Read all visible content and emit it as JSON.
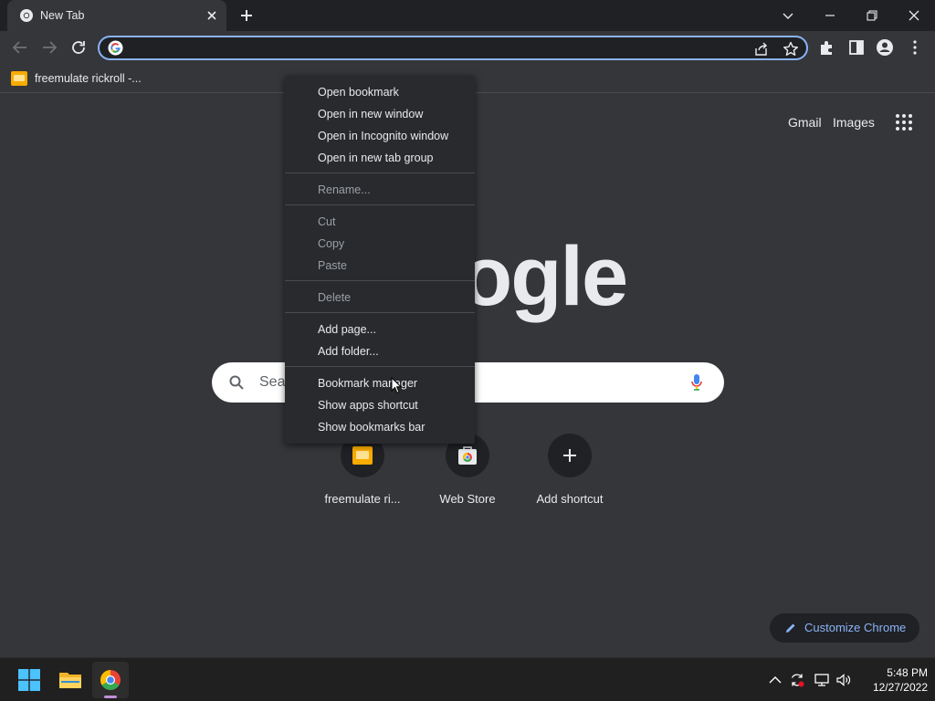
{
  "tab": {
    "title": "New Tab"
  },
  "omnibox": {
    "value": ""
  },
  "bookmarks_bar": {
    "items": [
      {
        "label": "freemulate rickroll -..."
      }
    ]
  },
  "ntp": {
    "top_links": {
      "gmail": "Gmail",
      "images": "Images"
    },
    "logo_partial": "ogle",
    "search_placeholder_partial": "Sea",
    "shortcuts": [
      {
        "label": "freemulate ri..."
      },
      {
        "label": "Web Store"
      },
      {
        "label": "Add shortcut"
      }
    ],
    "customize_label": "Customize Chrome"
  },
  "context_menu": {
    "items": [
      {
        "label": "Open bookmark",
        "enabled": true
      },
      {
        "label": "Open in new window",
        "enabled": true
      },
      {
        "label": "Open in Incognito window",
        "enabled": true
      },
      {
        "label": "Open in new tab group",
        "enabled": true
      },
      {
        "label": "Rename...",
        "enabled": false
      },
      {
        "label": "Cut",
        "enabled": false
      },
      {
        "label": "Copy",
        "enabled": false
      },
      {
        "label": "Paste",
        "enabled": false
      },
      {
        "label": "Delete",
        "enabled": false
      },
      {
        "label": "Add page...",
        "enabled": true
      },
      {
        "label": "Add folder...",
        "enabled": true
      },
      {
        "label": "Bookmark manager",
        "enabled": true
      },
      {
        "label": "Show apps shortcut",
        "enabled": true
      },
      {
        "label": "Show bookmarks bar",
        "enabled": true
      }
    ]
  },
  "taskbar": {
    "clock": {
      "time": "5:48 PM",
      "date": "12/27/2022"
    }
  },
  "colors": {
    "accent": "#8ab4f8",
    "chrome_bg": "#35363a",
    "frame_bg": "#202124",
    "menu_bg": "#292a2d"
  }
}
